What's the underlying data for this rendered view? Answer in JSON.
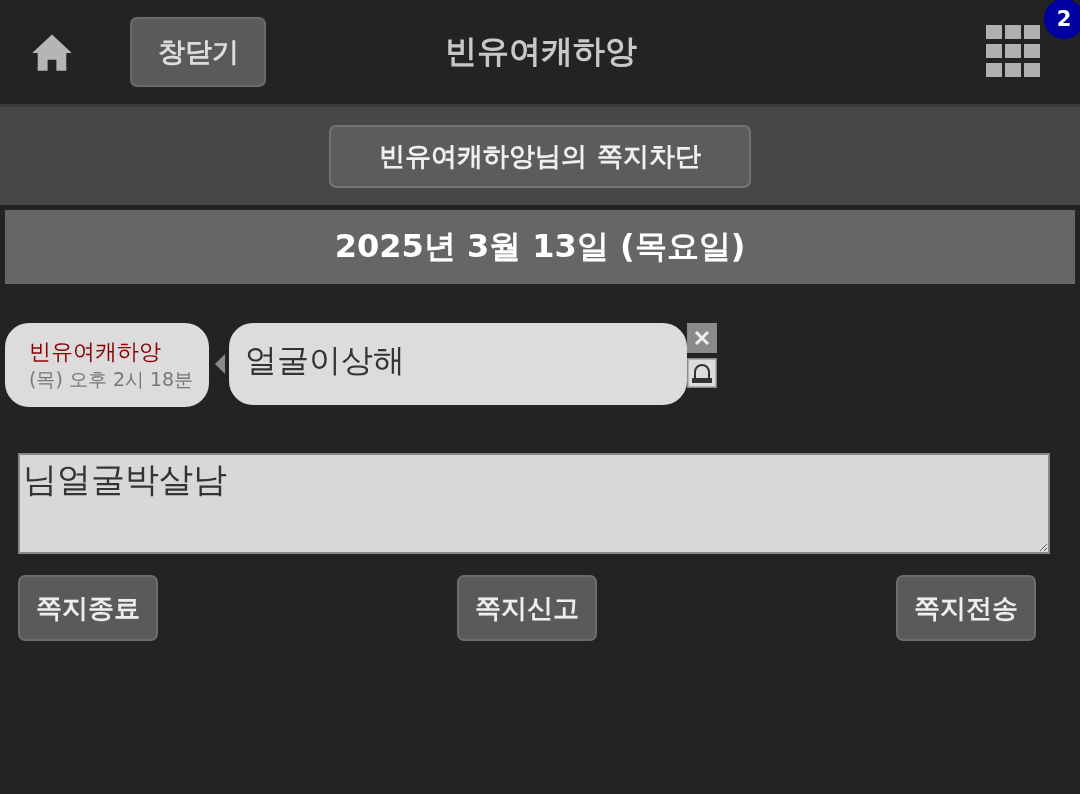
{
  "header": {
    "close_button": "창닫기",
    "title": "빈유여캐하앙",
    "badge": "2"
  },
  "block_button": "빈유여캐하앙님의 쪽지차단",
  "date": "2025년 3월 13일 (목요일)",
  "messages": [
    {
      "sender": "빈유여캐하앙",
      "time": "(목) 오후 2시 18분",
      "text": "얼굴이상해"
    }
  ],
  "compose": {
    "value": "님얼굴박살남"
  },
  "buttons": [
    "쪽지종료",
    "쪽지신고",
    "쪽지전송"
  ]
}
